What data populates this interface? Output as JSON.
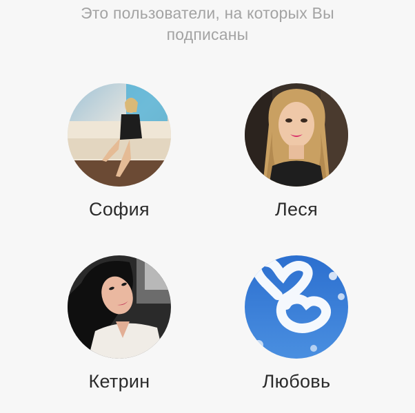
{
  "header": {
    "line1": "Это пользователи, на которых Вы",
    "line2": "подписаны"
  },
  "users": [
    {
      "name": "София",
      "avatar_icon": "sofia-photo"
    },
    {
      "name": "Леся",
      "avatar_icon": "lesya-photo"
    },
    {
      "name": "Кетрин",
      "avatar_icon": "ketrin-photo"
    },
    {
      "name": "Любовь",
      "avatar_icon": "lubov-heart-clouds"
    }
  ]
}
